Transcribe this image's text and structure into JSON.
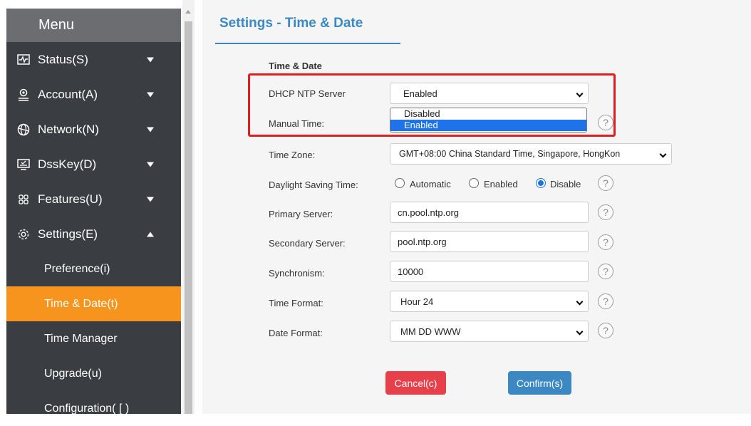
{
  "sidebar": {
    "header": "Menu",
    "items": [
      {
        "label": "Status(S)",
        "icon": "status-monitor-icon"
      },
      {
        "label": "Account(A)",
        "icon": "account-user-icon"
      },
      {
        "label": "Network(N)",
        "icon": "network-globe-icon"
      },
      {
        "label": "DssKey(D)",
        "icon": "dsskey-keyboard-icon"
      },
      {
        "label": "Features(U)",
        "icon": "features-grid-icon"
      },
      {
        "label": "Settings(E)",
        "icon": "settings-gear-icon"
      }
    ],
    "sub_items": [
      {
        "label": "Preference(i)"
      },
      {
        "label": "Time & Date(t)"
      },
      {
        "label": "Time Manager"
      },
      {
        "label": "Upgrade(u)"
      },
      {
        "label": "Configuration( [ )"
      }
    ]
  },
  "page": {
    "title": "Settings - Time & Date",
    "section": "Time & Date"
  },
  "form": {
    "dhcp_ntp_label": "DHCP NTP Server",
    "dhcp_ntp_value": "Enabled",
    "dhcp_ntp_options": [
      "Disabled",
      "Enabled"
    ],
    "manual_time_label": "Manual Time:",
    "time_zone_label": "Time Zone:",
    "time_zone_value": "GMT+08:00 China Standard Time, Singapore, HongKon",
    "dst_label": "Daylight Saving Time:",
    "dst_options": [
      "Automatic",
      "Enabled",
      "Disable"
    ],
    "dst_selected": "Disable",
    "primary_label": "Primary Server:",
    "primary_value": "cn.pool.ntp.org",
    "secondary_label": "Secondary Server:",
    "secondary_value": "pool.ntp.org",
    "sync_label": "Synchronism:",
    "sync_value": "10000",
    "time_format_label": "Time Format:",
    "time_format_value": "Hour 24",
    "date_format_label": "Date Format:",
    "date_format_value": "MM DD WWW",
    "help_glyph": "?"
  },
  "buttons": {
    "cancel": "Cancel(c)",
    "confirm": "Confirm(s)"
  },
  "colors": {
    "accent": "#3b88c3",
    "active_menu": "#f7941d",
    "cancel": "#e8404a",
    "highlight": "#e02020",
    "sidebar": "#3a3d41"
  }
}
